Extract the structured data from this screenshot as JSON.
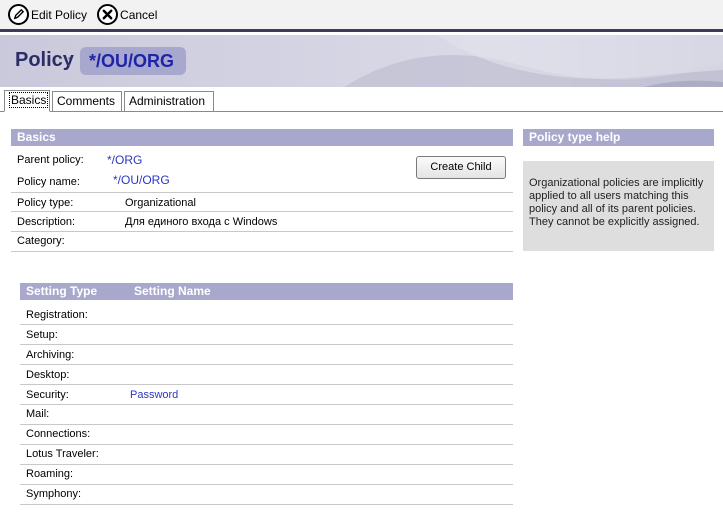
{
  "toolbar": {
    "edit_label": "Edit Policy",
    "cancel_label": "Cancel"
  },
  "banner": {
    "title": "Policy",
    "separator": ":",
    "policy_name": "*/OU/ORG"
  },
  "tabs": [
    {
      "label": "Basics"
    },
    {
      "label": "Comments"
    },
    {
      "label": "Administration"
    }
  ],
  "basics": {
    "header": "Basics",
    "parent_policy_label": "Parent policy:",
    "parent_policy_value": "*/ORG",
    "policy_name_label": "Policy name:",
    "policy_name_value": "*/OU/ORG",
    "policy_type_label": "Policy type:",
    "policy_type_value": "Organizational",
    "description_label": "Description:",
    "description_value": "Для единого входа с Windows",
    "category_label": "Category:",
    "category_value": "",
    "create_child_label": "Create Child"
  },
  "help": {
    "header": "Policy type help",
    "text": "Organizational policies are implicitly applied to all users matching this policy and all of its parent policies. They cannot be explicitly assigned."
  },
  "settings": {
    "col_type": "Setting Type",
    "col_name": "Setting Name",
    "rows": [
      {
        "type": "Registration:",
        "name": ""
      },
      {
        "type": "Setup:",
        "name": ""
      },
      {
        "type": "Archiving:",
        "name": ""
      },
      {
        "type": "Desktop:",
        "name": ""
      },
      {
        "type": "Security:",
        "name": "Password"
      },
      {
        "type": "Mail:",
        "name": ""
      },
      {
        "type": "Connections:",
        "name": ""
      },
      {
        "type": "Lotus Traveler:",
        "name": ""
      },
      {
        "type": "Roaming:",
        "name": ""
      },
      {
        "type": "Symphony:",
        "name": ""
      }
    ]
  },
  "colors": {
    "section_header": "#a8a8cc",
    "link": "#2c35c7",
    "banner_pill": "#a8a8cf"
  },
  "icons": {
    "edit": "pencil-circle-icon",
    "cancel": "x-circle-icon"
  }
}
